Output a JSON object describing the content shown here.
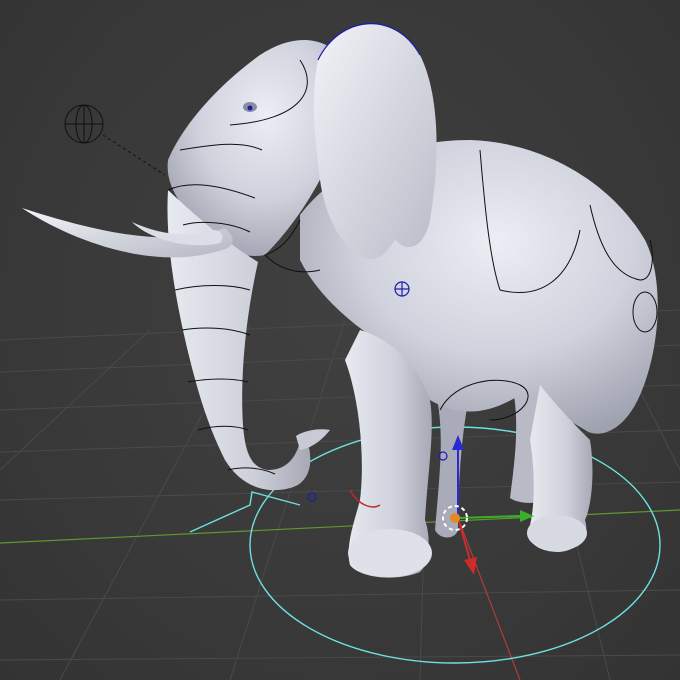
{
  "viewport": {
    "view": "3d-viewport-perspective",
    "object": "elephant-mesh-with-armature-rig",
    "colors": {
      "background": "#3a3a3a",
      "grid": "#4a4a4a",
      "x_axis": "#b43a3a",
      "y_axis": "#5e9a2e",
      "rig_control": "#6fe0e0",
      "bone_outline": "#101010",
      "selected_handle": "#1b1bb0",
      "mesh": "#d6d8e3"
    },
    "icons": [
      "camera-target-icon",
      "transform-gizmo-icon",
      "axis-arrow-x-icon",
      "axis-arrow-y-icon",
      "axis-arrow-z-icon",
      "3d-cursor-icon"
    ]
  }
}
